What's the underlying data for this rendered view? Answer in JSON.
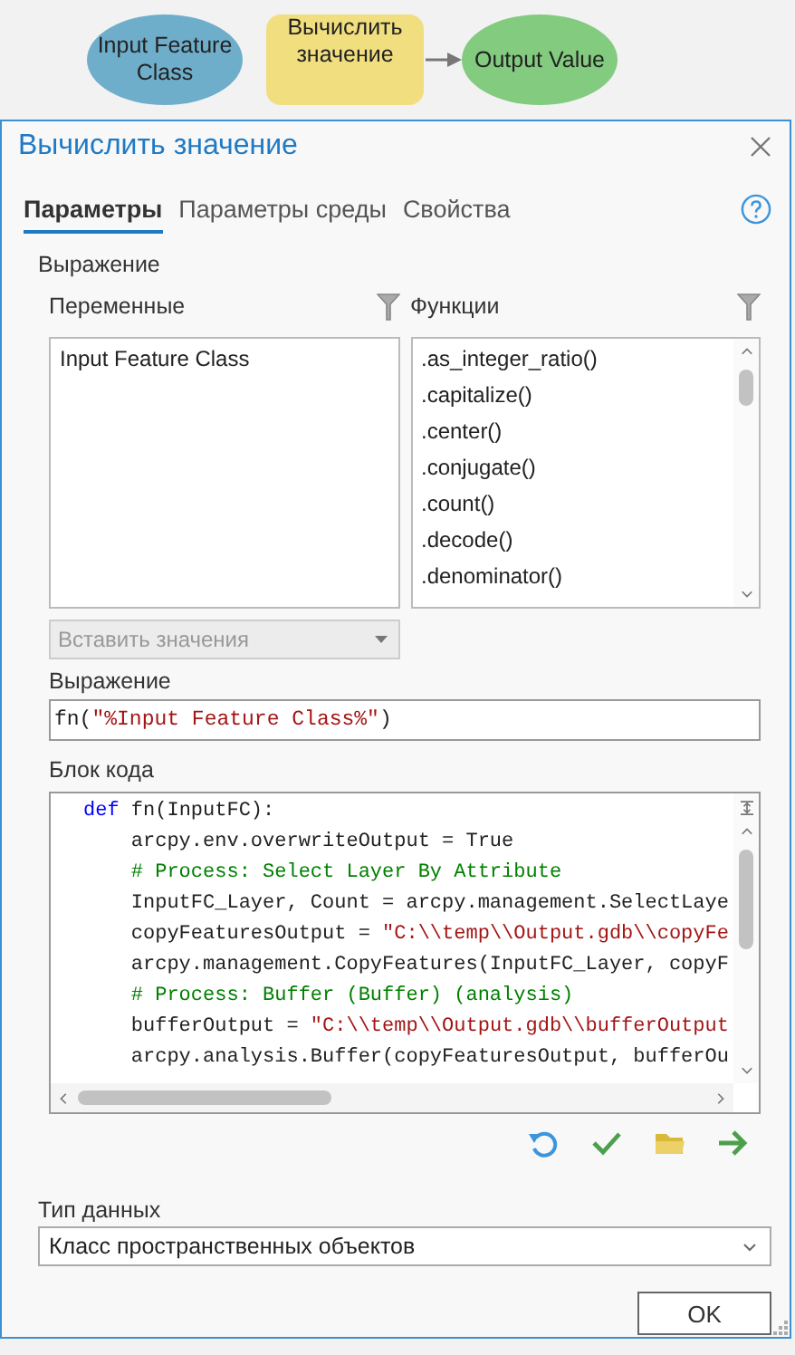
{
  "diagram": {
    "nodes": [
      {
        "kind": "data",
        "label": "Input Feature Class",
        "color": "#6faecb",
        "arrow_in": false
      },
      {
        "kind": "tool",
        "label": "Вычислить значение",
        "color": "#f1de7f",
        "arrow_in": false
      },
      {
        "kind": "data",
        "label": "Output Value",
        "color": "#83cb7f",
        "arrow_in": true
      }
    ]
  },
  "dialog": {
    "title": "Вычислить значение",
    "tabs": [
      {
        "label": "Параметры",
        "selected": true
      },
      {
        "label": "Параметры среды",
        "selected": false
      },
      {
        "label": "Свойства",
        "selected": false
      }
    ],
    "section": "Выражение",
    "variables": {
      "label": "Переменные",
      "items": [
        "Input Feature Class"
      ]
    },
    "functions": {
      "label": "Функции",
      "items": [
        ".as_integer_ratio()",
        ".capitalize()",
        ".center()",
        ".conjugate()",
        ".count()",
        ".decode()",
        ".denominator()"
      ]
    },
    "insert_values": {
      "value": "Вставить значения",
      "disabled": true
    },
    "expression": {
      "label": "Выражение",
      "tokens": [
        {
          "kind": "plain",
          "text": "fn("
        },
        {
          "kind": "string",
          "text": "\"%Input Feature Class%\""
        },
        {
          "kind": "plain",
          "text": ")"
        }
      ]
    },
    "code_block": {
      "label": "Блок кода",
      "lines": [
        {
          "tokens": [
            {
              "kind": "keyword",
              "text": "def"
            },
            {
              "kind": "plain",
              "text": " fn(InputFC):"
            }
          ]
        },
        {
          "tokens": [
            {
              "kind": "plain",
              "text": "    arcpy.env.overwriteOutput = True"
            }
          ]
        },
        {
          "tokens": [
            {
              "kind": "comment",
              "text": "    # Process: Select Layer By Attribute"
            }
          ]
        },
        {
          "tokens": [
            {
              "kind": "plain",
              "text": "    InputFC_Layer, Count = arcpy.management.SelectLaye"
            }
          ]
        },
        {
          "tokens": [
            {
              "kind": "plain",
              "text": "    copyFeaturesOutput = "
            },
            {
              "kind": "string",
              "text": "\"C:\\\\temp\\\\Output.gdb\\\\copyFe"
            }
          ]
        },
        {
          "tokens": [
            {
              "kind": "plain",
              "text": "    arcpy.management.CopyFeatures(InputFC_Layer, copyF"
            }
          ]
        },
        {
          "tokens": [
            {
              "kind": "comment",
              "text": "    # Process: Buffer (Buffer) (analysis)"
            }
          ]
        },
        {
          "tokens": [
            {
              "kind": "plain",
              "text": "    bufferOutput = "
            },
            {
              "kind": "string",
              "text": "\"C:\\\\temp\\\\Output.gdb\\\\bufferOutput"
            }
          ]
        },
        {
          "tokens": [
            {
              "kind": "plain",
              "text": "    arcpy.analysis.Buffer(copyFeaturesOutput, bufferOu"
            }
          ]
        }
      ]
    },
    "data_type": {
      "label": "Тип данных",
      "value": "Класс пространственных объектов"
    },
    "ok_button": "OK"
  }
}
